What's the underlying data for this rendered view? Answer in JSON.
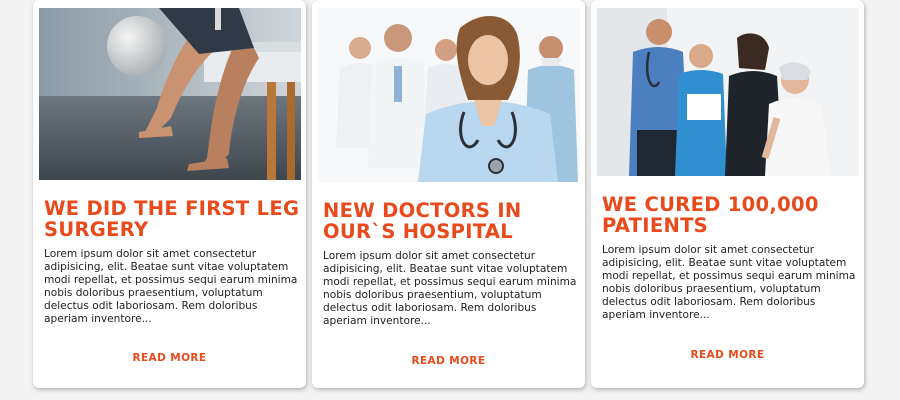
{
  "cards": [
    {
      "image_alt": "patient legs on exam table",
      "title": "WE DID THE FIRST LEG SURGERY",
      "body": "Lorem ipsum dolor sit amet consectetur adipisicing, elit. Beatae sunt vitae voluptatem modi repellat, et possimus sequi earum minima nobis doloribus praesentium, voluptatum delectus odit laboriosam. Rem doloribus aperiam inventore...",
      "link": "READ MORE"
    },
    {
      "image_alt": "team of doctors",
      "title": "NEW DOCTORS IN OUR`S HOSPITAL",
      "body": "Lorem ipsum dolor sit amet consectetur adipisicing, elit. Beatae sunt vitae voluptatem modi repellat, et possimus sequi earum minima nobis doloribus praesentium, voluptatum delectus odit laboriosam. Rem doloribus aperiam inventore...",
      "link": "READ MORE"
    },
    {
      "image_alt": "doctors with patients",
      "title": "WE CURED 100,000 PATIENTS",
      "body": "Lorem ipsum dolor sit amet consectetur adipisicing, elit. Beatae sunt vitae voluptatem modi repellat, et possimus sequi earum minima nobis doloribus praesentium, voluptatum delectus odit laboriosam. Rem doloribus aperiam inventore...",
      "link": "READ MORE"
    }
  ],
  "colors": {
    "accent": "#e84a1c",
    "text": "#222222",
    "background": "#f3f3f3",
    "card": "#ffffff"
  }
}
